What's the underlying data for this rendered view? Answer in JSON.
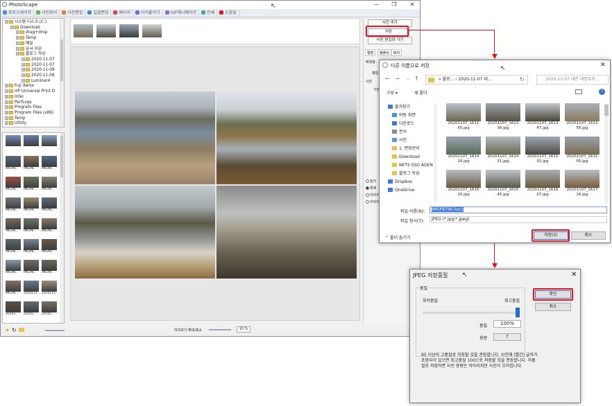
{
  "app": {
    "title": "PhotoScape",
    "menu_tabs": [
      "포토스케이프",
      "사진뷰어",
      "사진편집",
      "일괄편집",
      "페이지",
      "이어붙이기",
      "GIF애니메이션",
      "인쇄",
      "도움말"
    ],
    "menu_colors": [
      "#4a90d9",
      "#6cb34a",
      "#e37f2d",
      "#3a8fc8",
      "#d64a4a",
      "#6b6bd6",
      "#8c6cc6",
      "#4aa6a6",
      "#e8121a"
    ]
  },
  "tree": {
    "items": [
      {
        "label": "시스템 디스크 (C:)",
        "level": 0
      },
      {
        "label": "Download",
        "level": 1
      },
      {
        "label": "drag+drop",
        "level": 2
      },
      {
        "label": "Temp",
        "level": 2
      },
      {
        "label": "메일",
        "level": 2
      },
      {
        "label": "문서 이관",
        "level": 2
      },
      {
        "label": "블로그 작성",
        "level": 2
      },
      {
        "label": "2020-11-07",
        "level": 3
      },
      {
        "label": "2020-11-07",
        "level": 3
      },
      {
        "label": "2020-11-08",
        "level": 3
      },
      {
        "label": "2020-11-08",
        "level": 3
      },
      {
        "label": "Luminar4",
        "level": 3
      },
      {
        "label": "Fuji Xerox",
        "level": 0
      },
      {
        "label": "HP Universal Print D",
        "level": 0
      },
      {
        "label": "Intel",
        "level": 0
      },
      {
        "label": "PerfLogs",
        "level": 0
      },
      {
        "label": "Program Files",
        "level": 0
      },
      {
        "label": "Program Files (x86)",
        "level": 0
      },
      {
        "label": "Temp",
        "level": 0
      },
      {
        "label": "Utility",
        "level": 0
      }
    ]
  },
  "thumbs": {
    "labels": [
      "",
      "",
      "",
      "IMGP8...",
      "IMGP8...",
      "IMGP8...",
      "IMGP8...",
      "IMGP8...",
      "IMGP8...",
      "IMGP8...",
      "IMGP8...",
      "IMGP8...",
      "IMGP8...",
      "IMGP8...",
      "IMGP8...",
      "IMGP8...",
      "IMGP8...",
      "IMGP8...",
      "IMGP8...",
      "IMGP8...",
      "IMGP8...",
      "IMGP8...",
      "2020111...",
      "2020111...",
      "20201...",
      "20201...",
      "20201..."
    ]
  },
  "right_panel": {
    "add_photo": "사진 추가",
    "save": "저장",
    "send_to_editor": "사진 편집화 가기",
    "tabs": [
      "앨범",
      "템플릿",
      "배치"
    ],
    "label_ratio": "배경율",
    "label_merge": "병합",
    "label_photo": "사진",
    "label_zoom": "배율",
    "label_basic": "기본",
    "radios": [
      "높이",
      "폭에",
      "이미지",
      "이미지"
    ]
  },
  "canvas": {
    "zoom_label": "미리보기 확대/축소",
    "zoom_value": "10 %"
  },
  "save_dialog": {
    "title": "다른 이름으로 저장",
    "address": "« 블로... › 2020-11-07 대...",
    "search_placeholder": "2020-11-07 대전 대청호자...",
    "organize": "구성 ▾",
    "new_folder": "새 폴더",
    "nav": [
      "즐겨찾기",
      "바탕 화면",
      "다운로드",
      "문서",
      "사진",
      "1. 변화관리",
      "Download",
      "NETS SSO AGEN",
      "블로그 작성",
      "Dropbox",
      "OneDrive"
    ],
    "files": [
      "20201107_1612 55.jpg",
      "20201107_1613 36.jpg",
      "20201107_1613 47.jpg",
      "20201107_1613 56.jpg",
      "20201107_1614 16.jpg",
      "20201107_1614 31.jpg",
      "20201107_1615 01.jpg",
      "20201107_1615 05.jpg",
      "20201107_1615 20.jpg",
      "20201107_1615 45.jpg",
      "20201107_1616 07.jpg",
      "20201107_1617 16.jpg"
    ],
    "filename_label": "파일 이름(N):",
    "filename_value": "IMGP8796-horz",
    "filetype_label": "파일 형식(T):",
    "filetype_value": "JPEG (*.jpg;*.jpeg)",
    "hide_folders": "폴더 숨기기",
    "save_button": "저장(S)",
    "cancel_button": "취소"
  },
  "jpeg_dialog": {
    "title": "JPEG 저장품질",
    "group_label": "품질",
    "min_label": "최저품질",
    "max_label": "최고품질",
    "quality_label": "품질",
    "quality_value": "100%",
    "size_label": "용량",
    "size_value": "?",
    "ok_button": "확인",
    "cancel_button": "취소",
    "quality": 1.0,
    "note": "95 이상의 고품질로 저장할 것을 권장합니다. 사진에 (빨간) 글자가 포함되어 있으면 최고품질 100으로 저장할 것을 권장합니다. 저품질로 저장하면 사진 용량은 작아지지만 사진이 흐려집니다."
  },
  "colors": {
    "highlight": "#e8121a",
    "selection": "#3b78d8"
  }
}
